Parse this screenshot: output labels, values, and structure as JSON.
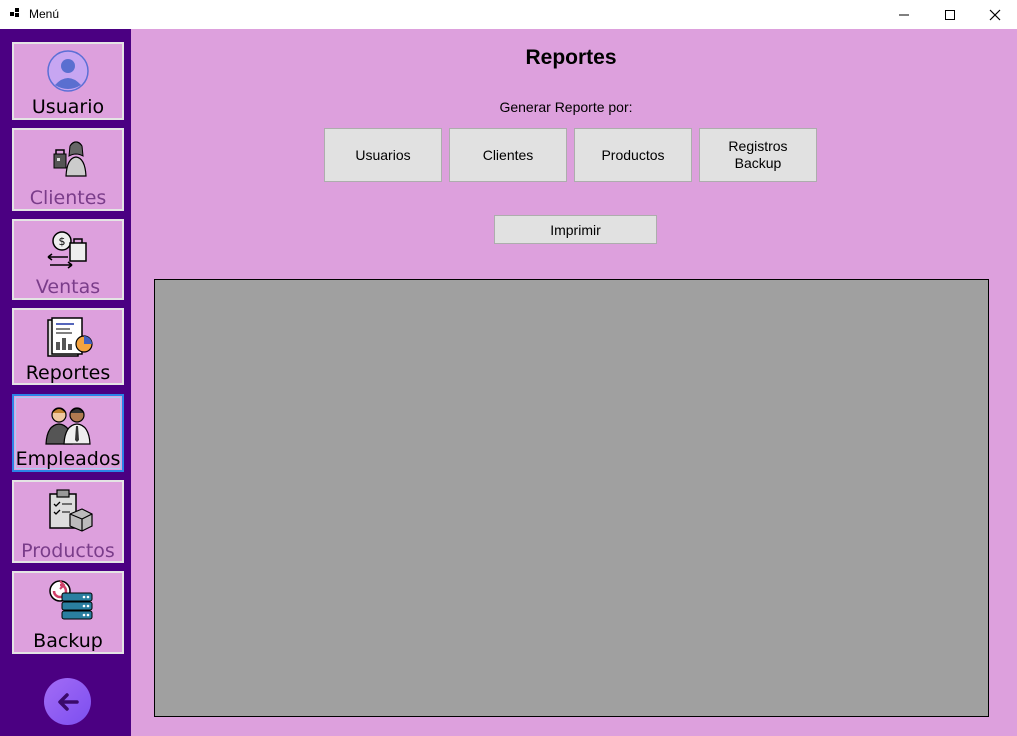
{
  "window": {
    "title": "Menú"
  },
  "sidebar": {
    "items": [
      {
        "label": "Usuario",
        "icon": "user-avatar-icon"
      },
      {
        "label": "Clientes",
        "icon": "clients-icon"
      },
      {
        "label": "Ventas",
        "icon": "sales-icon"
      },
      {
        "label": "Reportes",
        "icon": "reports-icon"
      },
      {
        "label": "Empleados",
        "icon": "employees-icon"
      },
      {
        "label": "Productos",
        "icon": "products-icon"
      },
      {
        "label": "Backup",
        "icon": "backup-icon"
      }
    ],
    "back_icon": "arrow-left-icon"
  },
  "main": {
    "title": "Reportes",
    "subtitle": "Generar Reporte por:",
    "report_buttons": [
      {
        "label": "Usuarios"
      },
      {
        "label": "Clientes"
      },
      {
        "label": "Productos"
      },
      {
        "label": "Registros\nBackup"
      }
    ],
    "print_label": "Imprimir"
  },
  "colors": {
    "sidebar": "#4b0082",
    "background": "#dda0dd",
    "report_area": "#a0a0a0",
    "button": "#e1e1e1",
    "active_border": "#2b84e6"
  }
}
